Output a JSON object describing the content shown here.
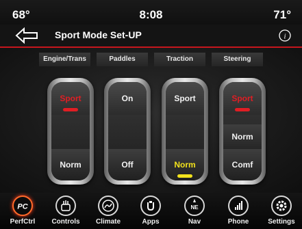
{
  "status": {
    "temp_left": "68°",
    "time": "8:08",
    "temp_right": "71°"
  },
  "header": {
    "title": "Sport Mode Set-UP"
  },
  "tabs": [
    "Engine/Trans",
    "Paddles",
    "Traction",
    "Steering"
  ],
  "controls": {
    "engine": {
      "top": "Sport",
      "bottom": "Norm",
      "selected": "Sport"
    },
    "paddles": {
      "top": "On",
      "bottom": "Off",
      "selected": "none"
    },
    "traction": {
      "top": "Sport",
      "bottom": "Norm",
      "selected": "Norm"
    },
    "steering": {
      "top": "Sport",
      "middle": "Norm",
      "bottom": "Comf",
      "selected": "Sport"
    }
  },
  "nav": {
    "perf_icon_text": "PC",
    "items": [
      "PerfCtrl",
      "Controls",
      "Climate",
      "Apps",
      "Nav",
      "Phone",
      "Settings"
    ]
  },
  "colors": {
    "accent_red": "#e01e24",
    "selected_yellow": "#f2e21c",
    "active_nav": "#ff6a2a"
  }
}
